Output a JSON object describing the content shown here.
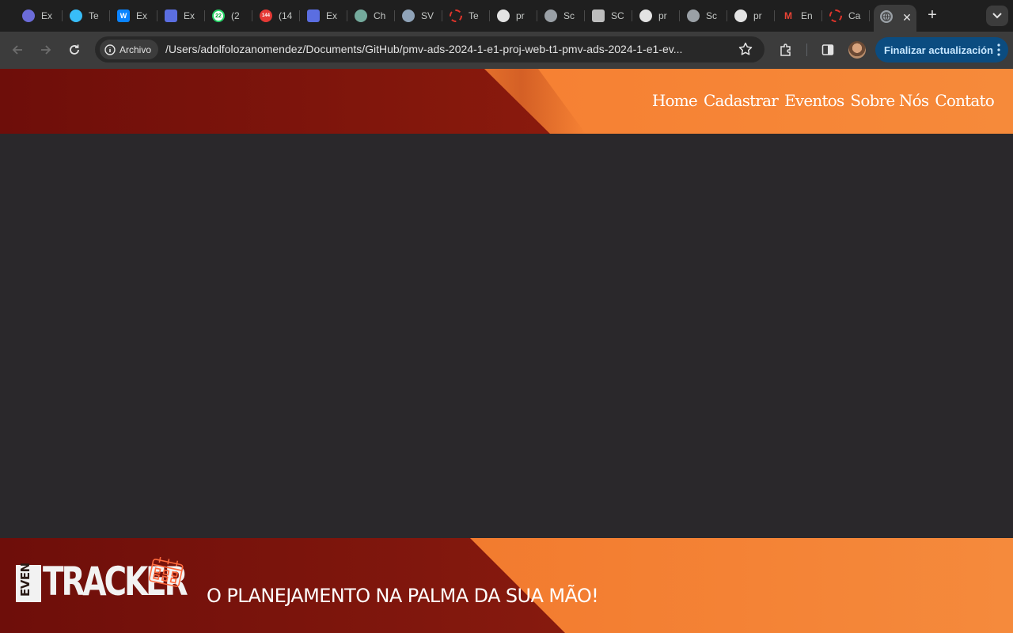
{
  "browser": {
    "tabs": [
      {
        "title": "Ex",
        "icon": "compass-icon",
        "color": "#6b6bd8"
      },
      {
        "title": "Te",
        "icon": "tailwind-icon",
        "color": "#38bdf8"
      },
      {
        "title": "Ex",
        "icon": "w-icon",
        "color": "#0a84ff"
      },
      {
        "title": "Ex",
        "icon": "tools-icon",
        "color": "#5b6ee1"
      },
      {
        "title": "(2",
        "icon": "whatsapp-icon",
        "color": "#25d366"
      },
      {
        "title": "(14",
        "icon": "badge-icon",
        "color": "#3949ab"
      },
      {
        "title": "Ex",
        "icon": "tools-icon",
        "color": "#5b6ee1"
      },
      {
        "title": "Ch",
        "icon": "chatgpt-icon",
        "color": "#74aa9c"
      },
      {
        "title": "SV",
        "icon": "shield-icon",
        "color": "#8fa3b8"
      },
      {
        "title": "Te",
        "icon": "dashed-circle-icon",
        "color": "#e0342b"
      },
      {
        "title": "pr",
        "icon": "github-icon",
        "color": "#e3e3e3"
      },
      {
        "title": "Sc",
        "icon": "globe-icon",
        "color": "#9aa0a6"
      },
      {
        "title": "SC",
        "icon": "crest-icon",
        "color": "#bdbdbd"
      },
      {
        "title": "pr",
        "icon": "github-icon",
        "color": "#e3e3e3"
      },
      {
        "title": "Sc",
        "icon": "globe-icon",
        "color": "#9aa0a6"
      },
      {
        "title": "pr",
        "icon": "github-icon",
        "color": "#e3e3e3"
      },
      {
        "title": "En",
        "icon": "gmail-icon",
        "color": "#ea4335"
      },
      {
        "title": "Ca",
        "icon": "dashed-circle-icon",
        "color": "#e0342b"
      }
    ],
    "active_tab": {
      "icon": "globe-icon",
      "close": "✕"
    },
    "new_tab": "+",
    "site_chip": "Archivo",
    "url": "/Users/adolfolozanomendez/Documents/GitHub/pmv-ads-2024-1-e1-proj-web-t1-pmv-ads-2024-1-e1-ev...",
    "update_button": "Finalizar actualización"
  },
  "header": {
    "nav": [
      "Home",
      "Cadastrar",
      "Eventos",
      "Sobre Nós",
      "Contato"
    ]
  },
  "footer": {
    "logo_even": "EVEN",
    "logo_tracker": "TRACKER",
    "tagline": "O PLANEJAMENTO NA PALMA DA SUA MÃO!"
  },
  "colors": {
    "dark_red": "#6e0e0a",
    "orange": "#f5762b",
    "page_bg": "#2a282b",
    "update_btn": "#0b4c80"
  }
}
